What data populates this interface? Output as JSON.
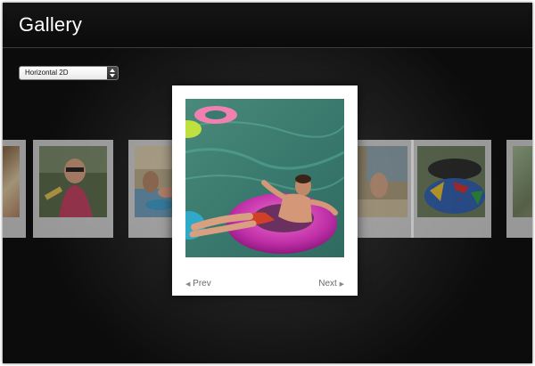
{
  "window": {
    "title": "Gallery"
  },
  "view_select": {
    "selected": "Horizontal 2D"
  },
  "navigation": {
    "prev_label": "Prev",
    "next_label": "Next"
  },
  "thumbnails_left": [
    "partial-thumbnail",
    "woman-with-sunglasses",
    "people-by-pool"
  ],
  "thumbnails_right": [
    "pool-edge",
    "colorful-pool-float",
    "partial-thumbnail"
  ],
  "main_photo": {
    "subject": "man-on-pink-inner-tube"
  },
  "colors": {
    "background": "#1a1a1a",
    "title_text": "#ffffff",
    "card": "#ffffff",
    "nav_text": "#6a6a6a"
  }
}
